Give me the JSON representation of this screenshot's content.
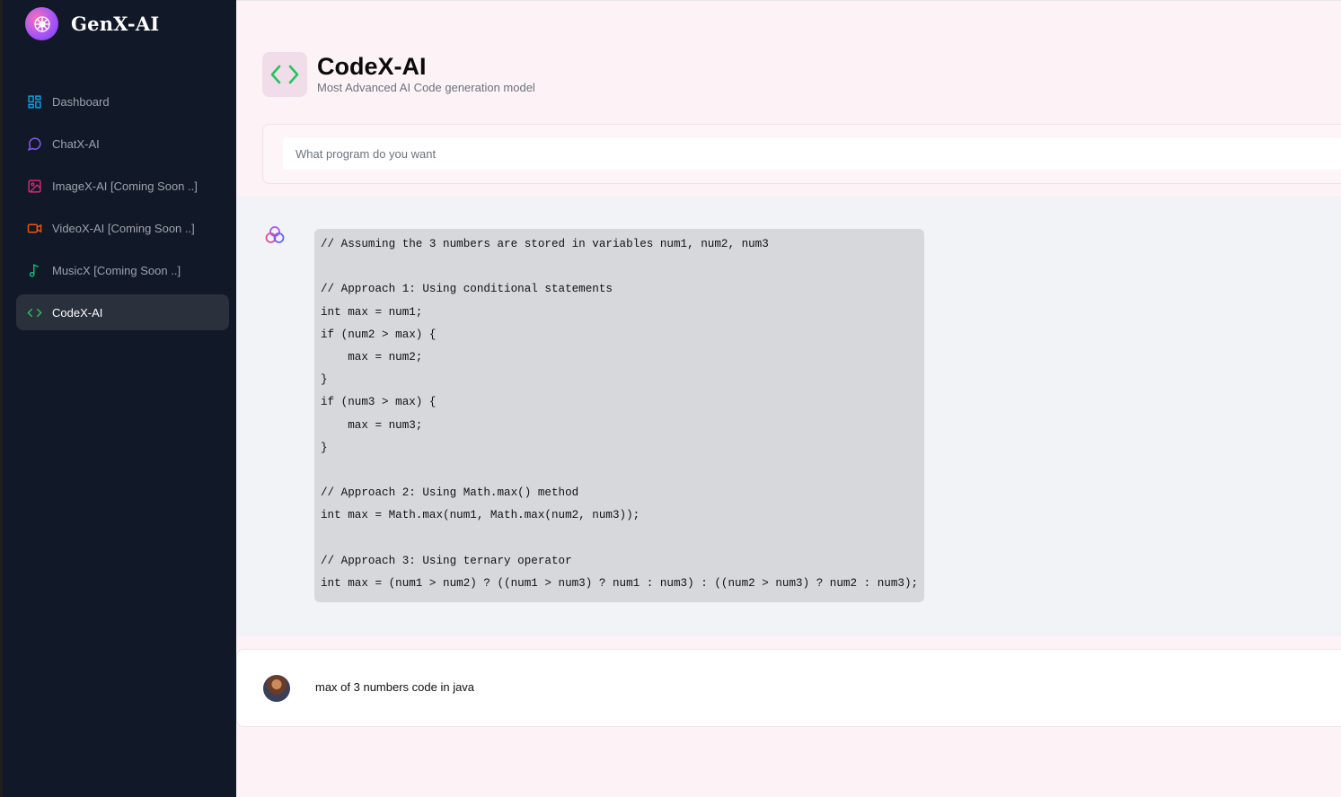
{
  "app": {
    "title": "GenX-AI"
  },
  "sidebar": {
    "items": [
      {
        "label": "Dashboard",
        "icon": "dashboard-grid-icon",
        "color": "#0ea5e9"
      },
      {
        "label": "ChatX-AI",
        "icon": "chat-bubble-icon",
        "color": "#8b5cf6"
      },
      {
        "label": "ImageX-AI [Coming Soon ..]",
        "icon": "image-icon",
        "color": "#db2777"
      },
      {
        "label": "VideoX-AI [Coming Soon ..]",
        "icon": "video-camera-icon",
        "color": "#ea580c"
      },
      {
        "label": "MusicX [Coming Soon ..]",
        "icon": "music-note-icon",
        "color": "#10b981"
      },
      {
        "label": "CodeX-AI",
        "icon": "code-brackets-icon",
        "color": "#22c55e",
        "active": true
      }
    ]
  },
  "header": {
    "title": "CodeX-AI",
    "subtitle": "Most Advanced AI Code generation model",
    "icon": "code-brackets-icon",
    "icon_color": "#22c55e"
  },
  "prompt": {
    "placeholder": "What program do you want",
    "value": ""
  },
  "conversation": {
    "bot_response": {
      "avatar_icon": "bot-rings-icon",
      "code_lines": [
        "// Assuming the 3 numbers are stored in variables num1, num2, num3",
        "",
        "// Approach 1: Using conditional statements",
        "int max = num1;",
        "if (num2 > max) {",
        "    max = num2;",
        "}",
        "if (num3 > max) {",
        "    max = num3;",
        "}",
        "",
        "// Approach 2: Using Math.max() method",
        "int max = Math.max(num1, Math.max(num2, num3));",
        "",
        "// Approach 3: Using ternary operator",
        "int max = (num1 > num2) ? ((num1 > num3) ? num1 : num3) : ((num2 > num3) ? num2 : num3);"
      ]
    },
    "user_message": {
      "text": "max of 3 numbers code in java",
      "avatar_icon": "user-avatar"
    }
  }
}
